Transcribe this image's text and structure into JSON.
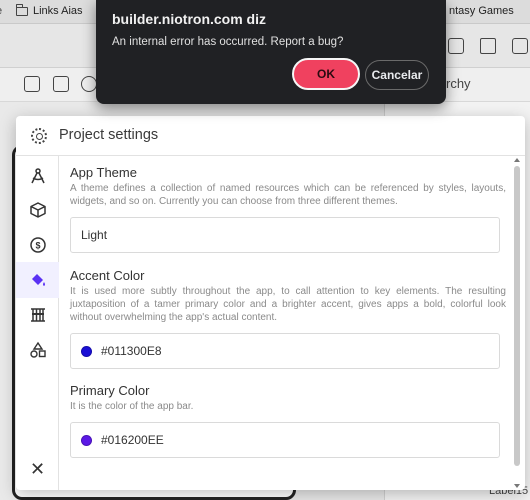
{
  "bookmarks": [
    {
      "label": "Links Aias"
    },
    {
      "label": "ntasy Games"
    }
  ],
  "background": {
    "hierarchy_label": "rchy",
    "label_item": "Label15"
  },
  "alert": {
    "title": "builder.niotron.com diz",
    "message": "An internal error has occurred. Report a bug?",
    "ok_label": "OK",
    "cancel_label": "Cancelar"
  },
  "modal": {
    "title": "Project settings",
    "nav": [
      {
        "icon": "compass-icon",
        "active": false
      },
      {
        "icon": "cube-icon",
        "active": false
      },
      {
        "icon": "dollar-coin-icon",
        "active": false
      },
      {
        "icon": "paint-bucket-icon",
        "active": true
      },
      {
        "icon": "abacus-icon",
        "active": false
      },
      {
        "icon": "shapes-icon",
        "active": false
      }
    ],
    "close_icon": "close-icon",
    "sections": {
      "theme": {
        "title": "App Theme",
        "description": "A theme defines a collection of named resources which can be referenced by styles, layouts, widgets, and so on. Currently you can choose from three different themes.",
        "value": "Light"
      },
      "accent": {
        "title": "Accent Color",
        "description": "It is used more subtly throughout the app, to call attention to key elements. The resulting juxtaposition of a tamer primary color and a brighter accent, gives apps a bold, colorful look without overwhelming the app's actual content.",
        "value": "#011300E8",
        "swatch": "#1a0fd6"
      },
      "primary": {
        "title": "Primary Color",
        "description": "It is the color of the app bar.",
        "value": "#016200EE",
        "swatch": "#5b18e6"
      }
    }
  },
  "colors": {
    "ok_button": "#f0415f",
    "active_nav": "#5a31f4",
    "alert_bg": "#202124"
  }
}
